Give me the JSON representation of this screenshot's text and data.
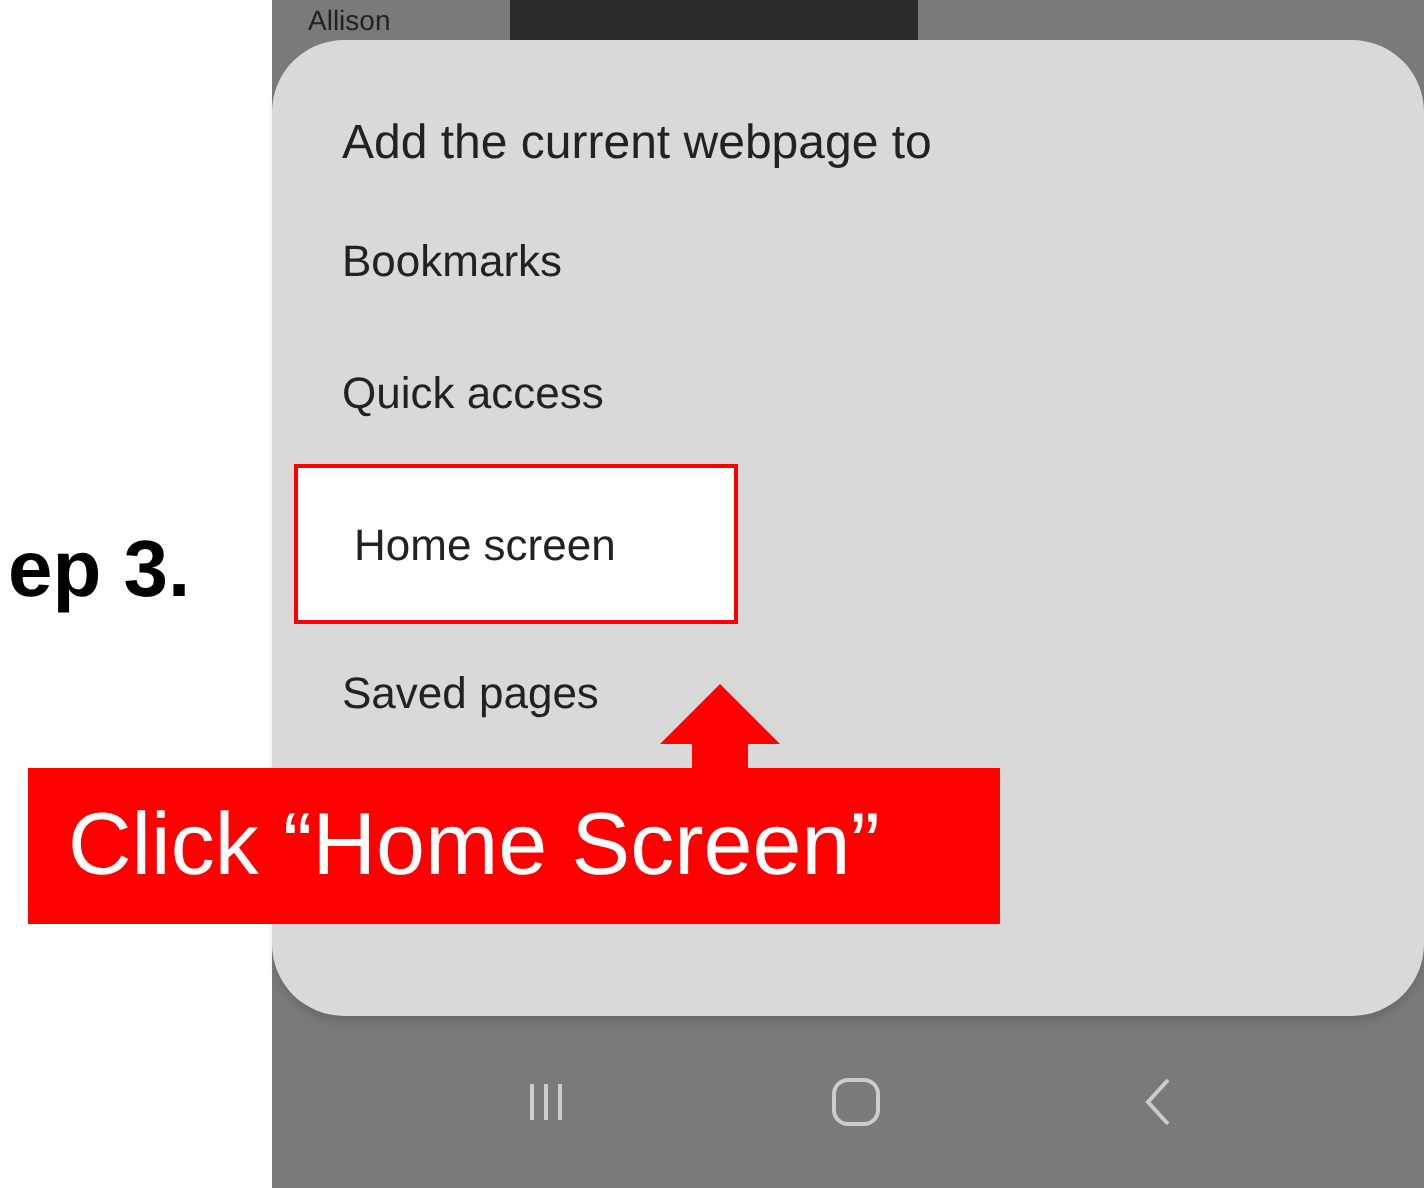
{
  "instruction": {
    "step_label": "ep 3.",
    "callout": "Click “Home Screen”"
  },
  "background": {
    "contact_name": "Allison"
  },
  "sheet": {
    "title": "Add the current webpage to",
    "options": [
      {
        "label": "Bookmarks",
        "selected": false
      },
      {
        "label": "Quick access",
        "selected": false
      },
      {
        "label": "Home screen",
        "selected": true
      },
      {
        "label": "Saved pages",
        "selected": false
      }
    ]
  }
}
